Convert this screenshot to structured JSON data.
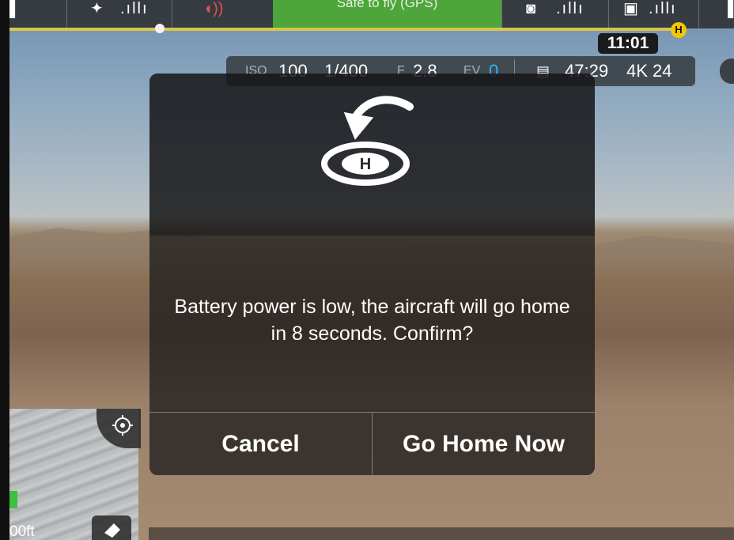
{
  "status_bar": {
    "safe_to_fly_label": "Safe to fly (GPS)",
    "flight_time": "11:01",
    "home_marker": "H"
  },
  "camera_settings": {
    "iso_label": "ISO",
    "iso_value": "100",
    "shutter": "1/400",
    "aperture_label": "F",
    "aperture_value": "2.8",
    "ev_label": "EV",
    "ev_value": "0",
    "remaining_time": "47:29",
    "video_format": "4K 24"
  },
  "dialog": {
    "icon": "return-to-home-icon",
    "message": "Battery power is low, the aircraft will go home in 8 seconds. Confirm?",
    "cancel_label": "Cancel",
    "confirm_label": "Go Home Now"
  },
  "minimap": {
    "scale_label": "00ft"
  },
  "colors": {
    "safe_banner": "#4ea53a",
    "home_marker": "#f0c800",
    "progress": "#d8c64a",
    "ev_value": "#2eb5ff"
  }
}
